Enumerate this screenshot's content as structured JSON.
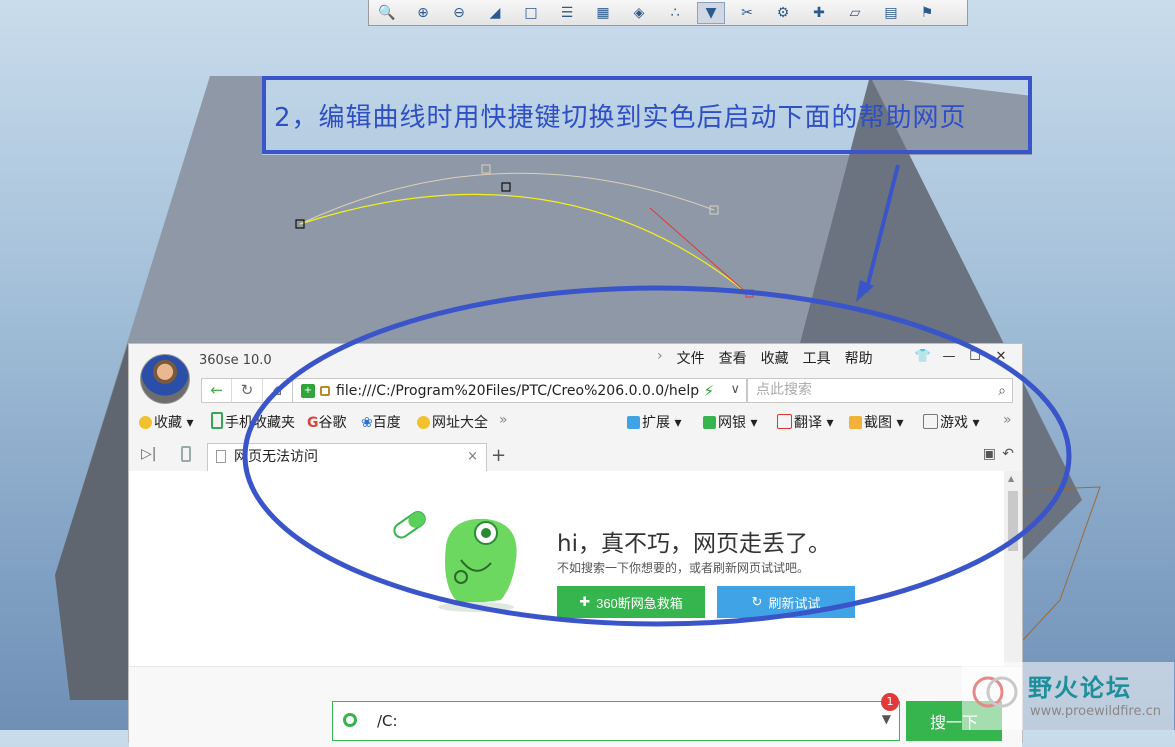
{
  "cad_toolbar": {
    "icons": [
      "zoom-fit-icon",
      "zoom-in-icon",
      "zoom-out-icon",
      "repaint-icon",
      "view-orient-icon",
      "saved-views-icon",
      "snapshot-icon",
      "display-style-icon",
      "datum-points-icon",
      "spin-center-icon",
      "datum-axes-icon",
      "annotation-display-icon",
      "plane-display-icon",
      "csys-display-icon",
      "perspective-icon",
      "bookmark-icon"
    ]
  },
  "annotation": {
    "text": "2，编辑曲线时用快捷键切换到实色后启动下面的帮助网页",
    "color": "#3955c9"
  },
  "browser": {
    "app_name": "360se 10.0",
    "menu": [
      "文件",
      "查看",
      "收藏",
      "工具",
      "帮助"
    ],
    "window_controls": [
      "👕",
      "—",
      "☐",
      "✕"
    ],
    "url": "file:///C:/Program%20Files/PTC/Creo%206.0.0.0/help",
    "search_placeholder": "点此搜索",
    "bookmarks": {
      "favorites": "收藏",
      "mobile_favorites": "手机收藏夹",
      "google": "谷歌",
      "baidu": "百度",
      "site_nav": "网址大全",
      "more": "»",
      "extensions": "扩展",
      "bank": "网银",
      "translate": "翻译",
      "screenshot": "截图",
      "games": "游戏",
      "overflow": "»"
    },
    "tab": {
      "title": "网页无法访问",
      "close": "×",
      "new_tab": "+"
    },
    "error_page": {
      "headline": "hi，真不巧，网页走丢了。",
      "subtext": "不如搜索一下你想要的，或者刷新网页试试吧。",
      "rescue_button": "360断网急救箱",
      "refresh_button": "刷新试试"
    },
    "bottom_search": {
      "value": "/C:",
      "badge": "1",
      "submit": "搜一下"
    }
  },
  "watermark": {
    "title": "野火论坛",
    "url": "www.proewildfire.cn"
  },
  "colors": {
    "accent_green": "#36b44d",
    "accent_blue": "#3fa3e6",
    "annotation_blue": "#3955c9"
  }
}
